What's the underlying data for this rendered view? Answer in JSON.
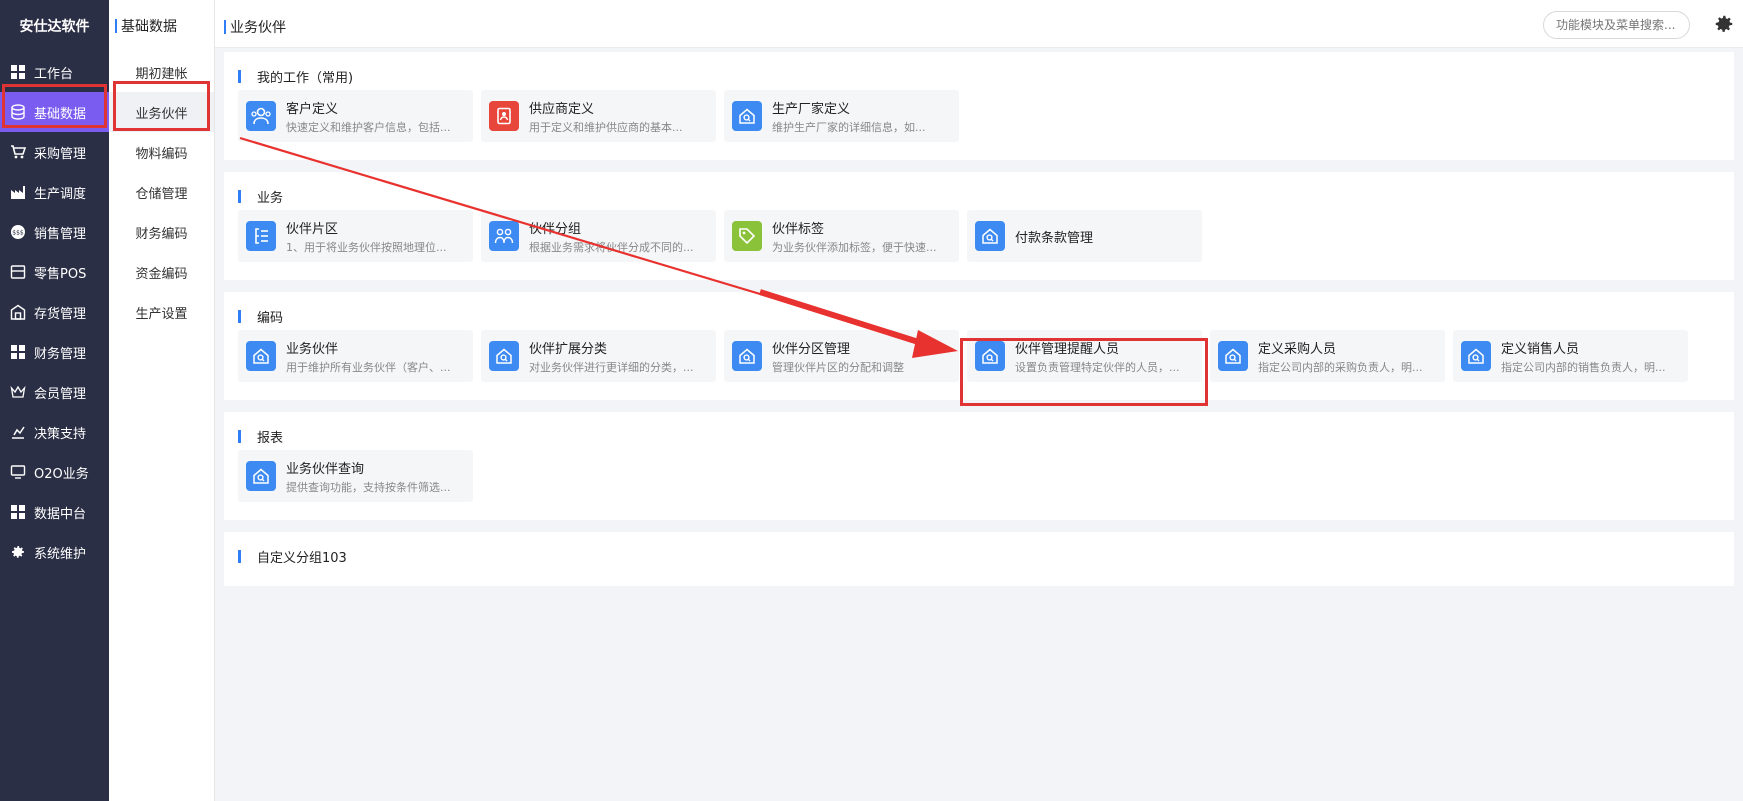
{
  "sidebar": {
    "brand": "安仕达软件",
    "items": [
      {
        "label": "工作台",
        "icon": "grid-icon"
      },
      {
        "label": "基础数据",
        "icon": "database-icon"
      },
      {
        "label": "采购管理",
        "icon": "cart-icon"
      },
      {
        "label": "生产调度",
        "icon": "factory-icon"
      },
      {
        "label": "销售管理",
        "icon": "sales-icon"
      },
      {
        "label": "零售POS",
        "icon": "pos-icon"
      },
      {
        "label": "存货管理",
        "icon": "warehouse-icon"
      },
      {
        "label": "财务管理",
        "icon": "grid-icon"
      },
      {
        "label": "会员管理",
        "icon": "crown-icon"
      },
      {
        "label": "决策支持",
        "icon": "chart-icon"
      },
      {
        "label": "O2O业务",
        "icon": "monitor-icon"
      },
      {
        "label": "数据中台",
        "icon": "grid-icon"
      },
      {
        "label": "系统维护",
        "icon": "gear-icon"
      }
    ],
    "active_index": 1
  },
  "submenu": {
    "title": "基础数据",
    "items": [
      "期初建帐",
      "业务伙伴",
      "物料编码",
      "仓储管理",
      "财务编码",
      "资金编码",
      "生产设置"
    ],
    "active_index": 1
  },
  "topbar": {
    "breadcrumb": "业务伙伴",
    "search_placeholder": "功能模块及菜单搜索..."
  },
  "sections": [
    {
      "title": "我的工作（常用)",
      "cards": [
        {
          "name": "客户定义",
          "desc": "快速定义和维护客户信息，包括...",
          "icon": "customer-icon",
          "color": "#3d8bf2"
        },
        {
          "name": "供应商定义",
          "desc": "用于定义和维护供应商的基本...",
          "icon": "supplier-icon",
          "color": "#e8463b"
        },
        {
          "name": "生产厂家定义",
          "desc": "维护生产厂家的详细信息，如...",
          "icon": "house-search-icon",
          "color": "#3d8bf2"
        }
      ]
    },
    {
      "title": "业务",
      "cards": [
        {
          "name": "伙伴片区",
          "desc": "1、用于将业务伙伴按照地理位...",
          "icon": "region-icon",
          "color": "#3d8bf2"
        },
        {
          "name": "伙伴分组",
          "desc": "根据业务需求将伙伴分成不同的...",
          "icon": "group-icon",
          "color": "#3d8bf2"
        },
        {
          "name": "伙伴标签",
          "desc": "为业务伙伴添加标签，便于快速...",
          "icon": "tag-icon",
          "color": "#8ac23a"
        },
        {
          "name": "付款条款管理",
          "desc": "",
          "icon": "house-search-icon",
          "color": "#3d8bf2"
        }
      ]
    },
    {
      "title": "编码",
      "cards": [
        {
          "name": "业务伙伴",
          "desc": "用于维护所有业务伙伴（客户、...",
          "icon": "house-search-icon",
          "color": "#3d8bf2"
        },
        {
          "name": "伙伴扩展分类",
          "desc": "对业务伙伴进行更详细的分类，...",
          "icon": "house-search-icon",
          "color": "#3d8bf2"
        },
        {
          "name": "伙伴分区管理",
          "desc": "管理伙伴片区的分配和调整",
          "icon": "house-search-icon",
          "color": "#3d8bf2"
        },
        {
          "name": "伙伴管理提醒人员",
          "desc": "设置负责管理特定伙伴的人员，...",
          "icon": "house-search-icon",
          "color": "#3d8bf2"
        },
        {
          "name": "定义采购人员",
          "desc": "指定公司内部的采购负责人，明...",
          "icon": "house-search-icon",
          "color": "#3d8bf2"
        },
        {
          "name": "定义销售人员",
          "desc": "指定公司内部的销售负责人，明...",
          "icon": "house-search-icon",
          "color": "#3d8bf2"
        }
      ]
    },
    {
      "title": "报表",
      "cards": [
        {
          "name": "业务伙伴查询",
          "desc": "提供查询功能，支持按条件筛选...",
          "icon": "house-search-icon",
          "color": "#3d8bf2"
        }
      ]
    },
    {
      "title": "自定义分组103",
      "cards": []
    }
  ]
}
